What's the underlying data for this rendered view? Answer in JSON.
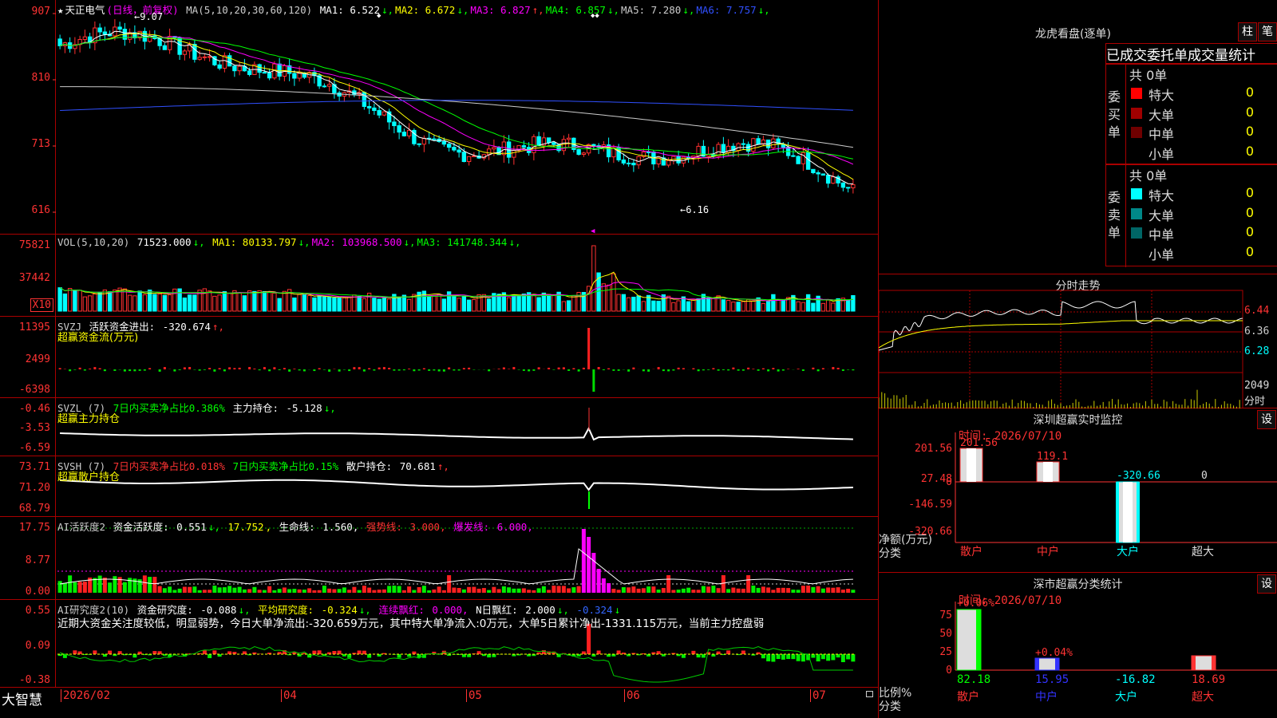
{
  "main": {
    "axis": [
      "907",
      "810",
      "713",
      "616"
    ],
    "title_star": "★",
    "stock_name": "天正电气",
    "period": "(日线，前复权)",
    "ma_label": "MA(5,10,20,30,60,120)",
    "ma": [
      {
        "label": "MA1:",
        "value": "6.522",
        "arrow": "↓",
        "color": "#ffffff"
      },
      {
        "label": "MA2:",
        "value": "6.672",
        "arrow": "↓",
        "color": "#ffff00"
      },
      {
        "label": "MA3:",
        "value": "6.827",
        "arrow": "↑",
        "color": "#ff00ff"
      },
      {
        "label": "MA4:",
        "value": "6.857",
        "arrow": "↓",
        "color": "#00ff00"
      },
      {
        "label": "MA5:",
        "value": "7.280",
        "arrow": "↓",
        "color": "#cccccc"
      },
      {
        "label": "MA6:",
        "value": "7.757",
        "arrow": "↓",
        "color": "#3050ff"
      }
    ],
    "high_marker": "9.07",
    "low_marker": "6.16"
  },
  "vol": {
    "axis": [
      "75821",
      "37442"
    ],
    "unit": "X10",
    "name": "VOL(5,10,20)",
    "value": "71523.000",
    "ma": [
      {
        "label": "MA1:",
        "value": "80133.797",
        "arrow": "↓",
        "color": "#ffff00"
      },
      {
        "label": "MA2:",
        "value": "103968.500",
        "arrow": "↓",
        "color": "#ff00ff"
      },
      {
        "label": "MA3:",
        "value": "141748.344",
        "arrow": "↓",
        "color": "#00ff00"
      }
    ]
  },
  "svzj": {
    "axis": [
      "11395",
      "2499",
      "-6398"
    ],
    "name": "SVZJ",
    "label": "活跃资金进出:",
    "value": "-320.674",
    "arrow": "↑,",
    "subtitle": "超赢资金流(万元)"
  },
  "svzl": {
    "axis": [
      "-0.46",
      "-3.53",
      "-6.59"
    ],
    "name": "SVZL (7)",
    "t1": "7日内买卖净占比0.386%",
    "t2": "主力持仓:",
    "value": "-5.128",
    "arrow": "↓,",
    "subtitle": "超赢主力持仓"
  },
  "svsh": {
    "axis": [
      "73.71",
      "71.20",
      "68.79"
    ],
    "name": "SVSH (7)",
    "t1": "7日内买卖净占比0.018%",
    "t2": "7日内买卖净占比0.15%",
    "t3": "散户持仓:",
    "value": "70.681",
    "arrow": "↑,",
    "subtitle": "超赢散户持仓"
  },
  "ai1": {
    "axis": [
      "17.75",
      "8.77",
      "0.00"
    ],
    "name": "AI活跃度2",
    "l1": "资金活跃度:",
    "v1": "0.551",
    "a1": "↓,",
    "v2": "17.752",
    "l3": "生命线:",
    "v3": "1.560,",
    "l4": "强势线:",
    "v4": "3.000,",
    "l5": "爆发线:",
    "v5": "6.000,"
  },
  "ai2": {
    "axis": [
      "0.55",
      "0.09",
      "-0.38"
    ],
    "name": "AI研究度2(10)",
    "l1": "资金研究度:",
    "v1": "-0.088",
    "a1": "↓,",
    "l2": "平均研究度:",
    "v2": "-0.324",
    "a2": "↓,",
    "l3": "连续飘红:",
    "v3": "0.000,",
    "l4": "N日飘红:",
    "v4": "2.000",
    "a4": "↓,",
    "v5": "-0.324",
    "a5": "↓",
    "comment": "近期大资金关注度较低，明显弱势，今日大单净流出:-320.659万元，其中特大单净流入:0万元，大单5日累计净出-1331.115万元，当前主力控盘弱"
  },
  "bottom": {
    "logo": "大智慧",
    "dates": [
      "2026/02",
      "04",
      "05",
      "06",
      "07"
    ]
  },
  "longhu": {
    "title": "龙虎看盘(逐单)",
    "btn1": "柱",
    "btn2": "笔",
    "tabs": "已成交委托单成交量统计",
    "buy_label": "委买单",
    "sell_label": "委卖单",
    "buy_total": "共 0单",
    "sell_total": "共 0单",
    "buy_rows": [
      {
        "label": "特大",
        "num": "0",
        "pct": "0%",
        "color": "#ff0000"
      },
      {
        "label": "大单",
        "num": "0",
        "pct": "0%",
        "color": "#a00000"
      },
      {
        "label": "中单",
        "num": "0",
        "pct": "0%",
        "color": "#700000"
      },
      {
        "label": "小单",
        "num": "0",
        "pct": "0%",
        "color": "#000000"
      }
    ],
    "sell_rows": [
      {
        "label": "特大",
        "num": "0",
        "pct": "0%",
        "color": "#00ffff"
      },
      {
        "label": "大单",
        "num": "0",
        "pct": "0%",
        "color": "#008888"
      },
      {
        "label": "中单",
        "num": "0",
        "pct": "0%",
        "color": "#006666"
      },
      {
        "label": "小单",
        "num": "0",
        "pct": "0%",
        "color": "#000000"
      }
    ]
  },
  "fenshi": {
    "title": "分时走势",
    "axis": [
      "6.44",
      "6.36",
      "6.28"
    ],
    "vol_axis": "2049",
    "vol_label": "分时"
  },
  "monitor": {
    "title": "深圳超赢实时监控",
    "btn": "设",
    "time": "时间: 2026/07/10",
    "axis": [
      "201.56",
      "27.48",
      "0",
      "-146.59",
      "-320.66"
    ],
    "unit1": "净额(万元)",
    "unit2": "分类",
    "values": [
      "201.56",
      "119.1",
      "-320.66",
      "0"
    ],
    "cats": [
      "散户",
      "中户",
      "大户",
      "超大"
    ]
  },
  "classstat": {
    "title": "深市超赢分类统计",
    "btn": "设",
    "time": "时间: 2026/07/10",
    "axis": [
      "75",
      "50",
      "25",
      "0"
    ],
    "unit1": "比例%",
    "unit2": "分类",
    "pct": [
      "+0.06%",
      "+0.04%"
    ],
    "values": [
      "82.18",
      "15.95",
      "-16.82",
      "18.69"
    ],
    "cats": [
      "散户",
      "中户",
      "大户",
      "超大"
    ]
  }
}
